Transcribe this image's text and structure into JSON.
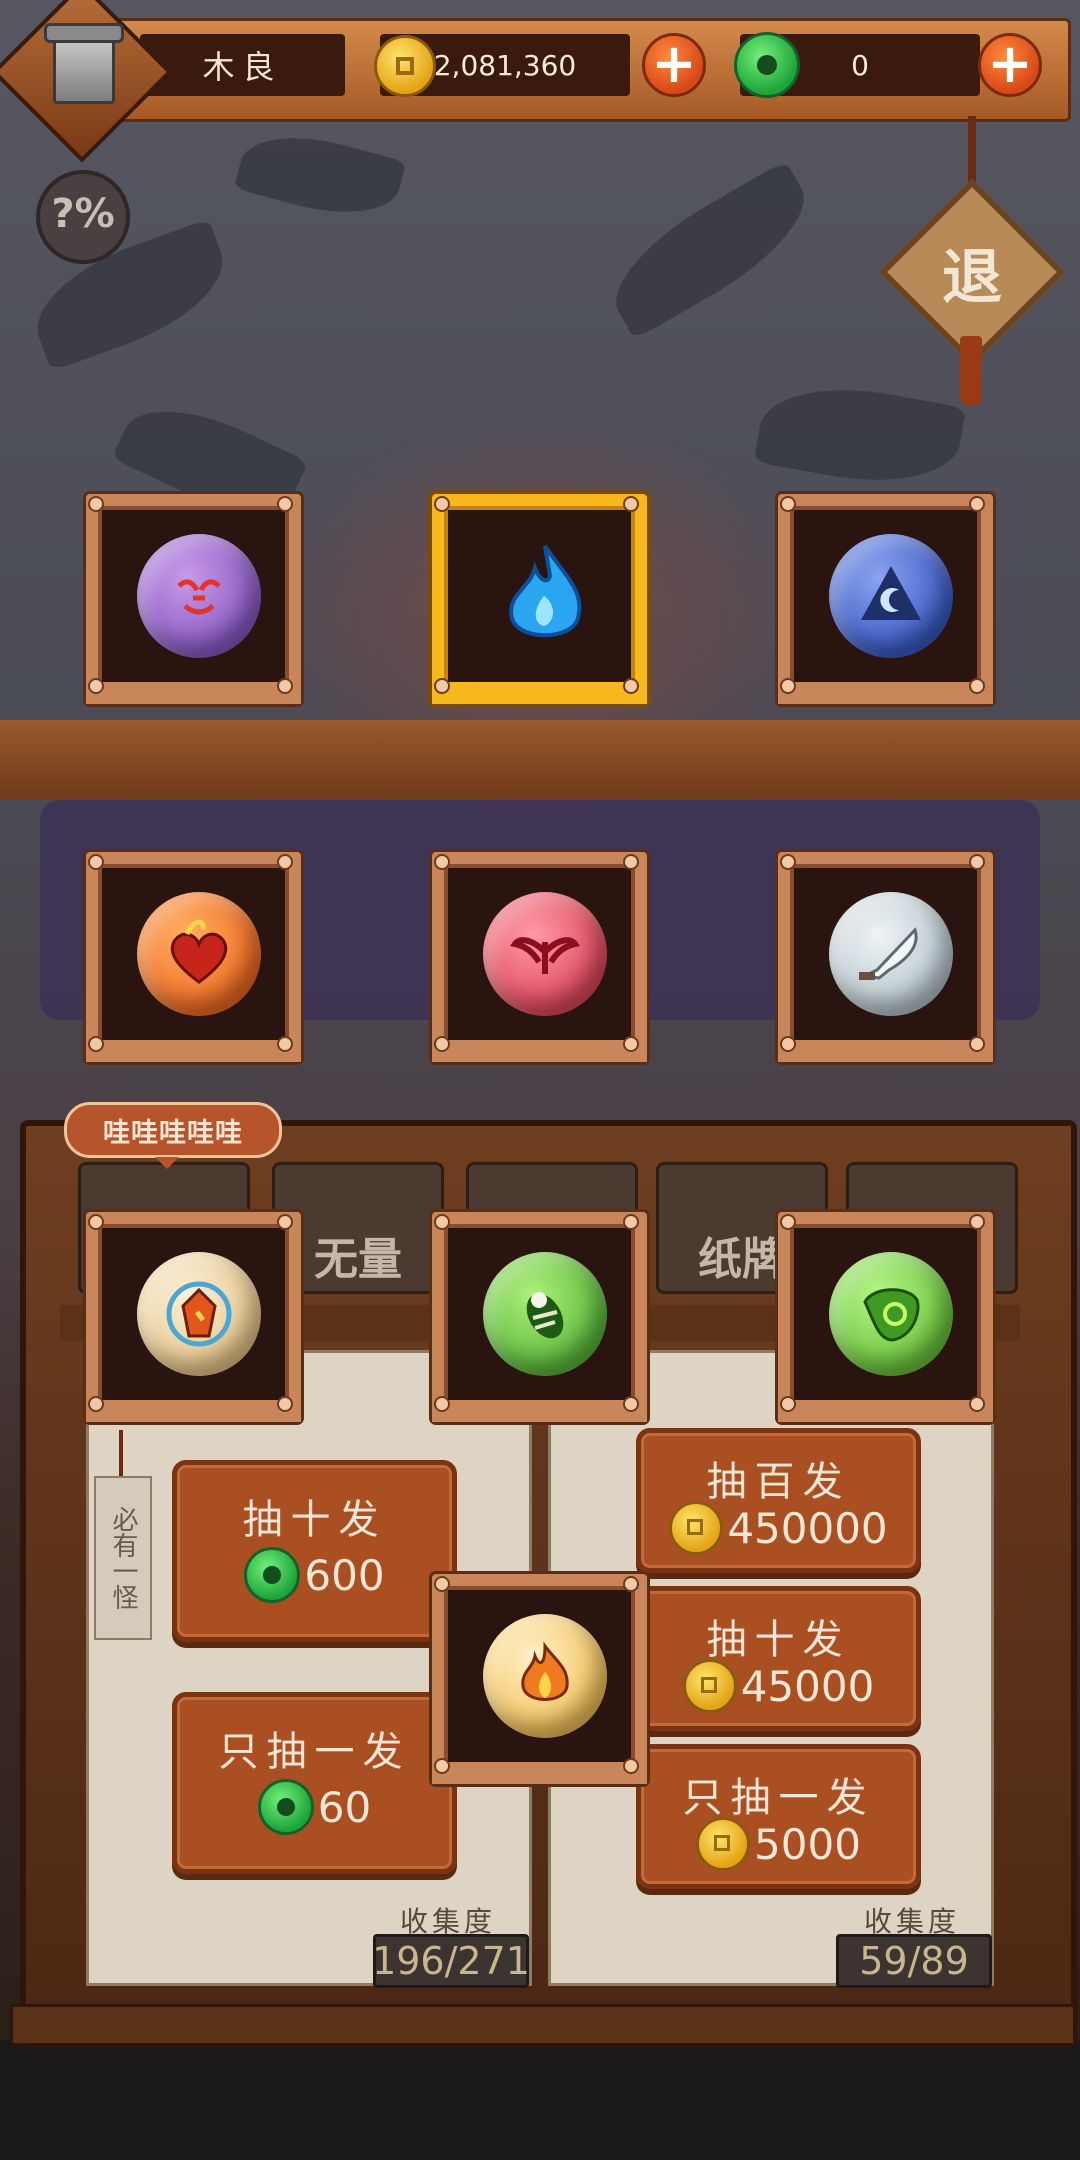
{
  "header": {
    "player_name": "木良",
    "coins": "2,081,360",
    "jade": "0"
  },
  "buttons": {
    "probability_label": "?%",
    "exit_label": "退"
  },
  "slots": [
    {
      "name": "purple-mask-orb",
      "icon": "purple-mask",
      "color": "#8a5ac4"
    },
    {
      "name": "blue-flame-orb",
      "icon": "blue-flame",
      "color": "#2a7fd6",
      "selected": true
    },
    {
      "name": "blue-moon-orb",
      "icon": "blue-moon",
      "color": "#3a5ac4"
    },
    {
      "name": "fire-heart-orb",
      "icon": "fire-heart",
      "color": "#f06a22"
    },
    {
      "name": "red-wings-orb",
      "icon": "red-wings",
      "color": "#e0485a"
    },
    {
      "name": "silver-blade-orb",
      "icon": "silver-blade",
      "color": "#b8c6cc"
    },
    {
      "name": "amber-crystal-orb",
      "icon": "amber-crystal",
      "color": "#e9c68a"
    },
    {
      "name": "green-beetle-orb",
      "icon": "green-beetle",
      "color": "#5ab83a"
    },
    {
      "name": "green-slime-orb",
      "icon": "green-slime",
      "color": "#6ac43a"
    },
    {
      "name": "golden-fire-orb",
      "icon": "golden-fire",
      "color": "#f3c25a"
    }
  ],
  "tabs": [
    {
      "label": ""
    },
    {
      "label": "无量"
    },
    {
      "label": ""
    },
    {
      "label": "纸牌"
    },
    {
      "label": ""
    }
  ],
  "speech_bubble": "哇哇哇哇哇",
  "side_tag": "必有一怪",
  "left_pool": {
    "draw_ten": {
      "title": "抽十发",
      "price": "600"
    },
    "draw_one": {
      "title": "只抽一发",
      "price": "60"
    },
    "collection_label": "收集度",
    "collection_value": "196/271"
  },
  "right_pool": {
    "draw_hundred": {
      "title": "抽百发",
      "price": "450000"
    },
    "draw_ten": {
      "title": "抽十发",
      "price": "45000"
    },
    "draw_one": {
      "title": "只抽一发",
      "price": "5000"
    },
    "collection_label": "收集度",
    "collection_value": "59/89"
  }
}
